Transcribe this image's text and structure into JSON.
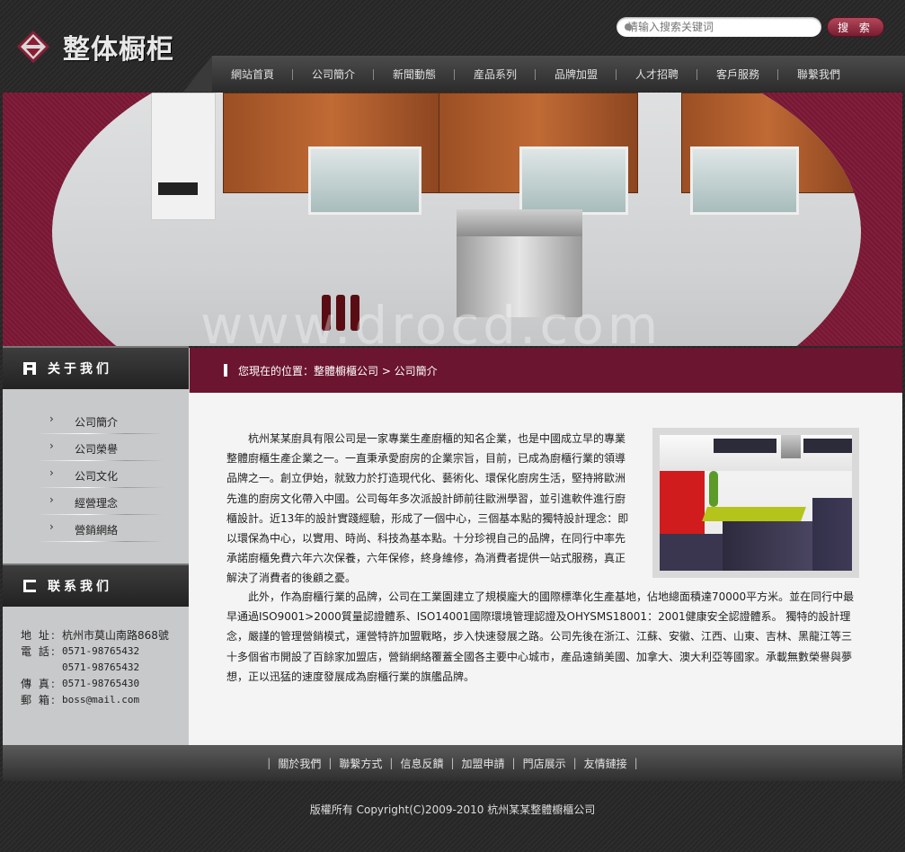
{
  "header": {
    "logo_text": "整体橱柜",
    "search": {
      "placeholder": "请输入搜索关键词",
      "button": "搜 索"
    },
    "nav": [
      "網站首頁",
      "公司簡介",
      "新聞動態",
      "産品系列",
      "品牌加盟",
      "人才招聘",
      "客戶服務",
      "聯繫我們"
    ]
  },
  "banner": {
    "watermark": "www.drocd.com"
  },
  "sidebar": {
    "about_title": "关于我们",
    "menu": [
      "公司簡介",
      "公司榮譽",
      "公司文化",
      "經營理念",
      "營銷網絡"
    ],
    "contact_title": "联系我们",
    "contact": [
      {
        "key": "地  址:",
        "value": "杭州市莫山南路868號"
      },
      {
        "key": "電  話:",
        "value": "0571-98765432"
      },
      {
        "key": "",
        "value": "0571-98765432"
      },
      {
        "key": "傳  真:",
        "value": "0571-98765430"
      },
      {
        "key": "郵  箱:",
        "value": "boss@mail.com"
      }
    ]
  },
  "breadcrumb": {
    "text": "您現在的位置：整體櫥櫃公司 > 公司簡介"
  },
  "content": {
    "para1": "杭州某某廚具有限公司是一家專業生產廚櫃的知名企業，也是中國成立早的專業整體廚櫃生產企業之一。一直秉承愛廚房的企業宗旨，目前，已成為廚櫃行業的領導品牌之一。創立伊始，就致力於打造現代化、藝術化、環保化廚房生活，堅持將歐洲先進的廚房文化帶入中國。公司每年多次派設計師前往歐洲學習，並引進軟件進行廚櫃設計。近13年的設計實踐經驗，形成了一個中心，三個基本點的獨特設計理念：即以環保為中心，以實用、時尚、科技為基本點。十分珍視自己的品牌，在同行中率先承諾廚櫃免費六年六次保養，六年保修，終身維修，為消費者提供一站式服務，真正解決了消費者的後顧之憂。",
    "para2": "此外，作為廚櫃行業的品牌，公司在工業園建立了規模龐大的國際標準化生產基地，佔地總面積達70000平方米。並在同行中最早通過ISO9001>2000質量認證體系、ISO14001國際環境管理認證及OHYSMS18001：2001健康安全認證體系。 獨特的設計理念，嚴謹的管理營銷模式，運營特許加盟戰略，步入快速發展之路。公司先後在浙江、江蘇、安徽、江西、山東、吉林、黑龍江等三十多個省市開設了百餘家加盟店，營銷網絡覆蓋全國各主要中心城市，產品遠銷美國、加拿大、澳大利亞等國家。承載無數榮譽與夢想，正以迅猛的速度發展成為廚櫃行業的旗艦品牌。"
  },
  "footer": {
    "links": [
      "關於我們",
      "聯繫方式",
      "信息反饋",
      "加盟申請",
      "門店展示",
      "友情鏈接"
    ],
    "copyright": "版權所有 Copyright(C)2009-2010 杭州某某整體櫥櫃公司"
  },
  "colors": {
    "accent": "#6b1530",
    "banner_bg": "#7a1a36",
    "dark": "#2a2a2a",
    "sidebar": "#c8c9ca"
  }
}
